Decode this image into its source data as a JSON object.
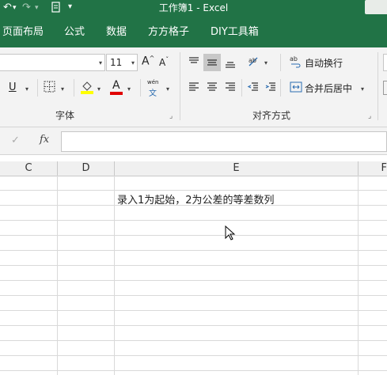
{
  "titlebar": {
    "title": "工作簿1  -  Excel"
  },
  "tabs": [
    "页面布局",
    "公式",
    "数据",
    "方方格子",
    "DIY工具箱"
  ],
  "font_group": {
    "font_size": "11",
    "grow_label": "A",
    "shrink_label": "A",
    "underline_label": "U",
    "font_color_label": "A",
    "phonetic_top": "wén",
    "phonetic_bottom": "文",
    "group_label": "字体",
    "highlight_color": "#ffff00",
    "font_color": "#e00000"
  },
  "align_group": {
    "wrap_text_label": "自动换行",
    "merge_center_label": "合并后居中",
    "group_label": "对齐方式"
  },
  "formula_bar": {
    "cancel": "✓",
    "fx": "fx",
    "value": ""
  },
  "columns": [
    "C",
    "D",
    "E",
    "F"
  ],
  "cells": {
    "E2": "录入1为起始，2为公差的等差数列"
  }
}
